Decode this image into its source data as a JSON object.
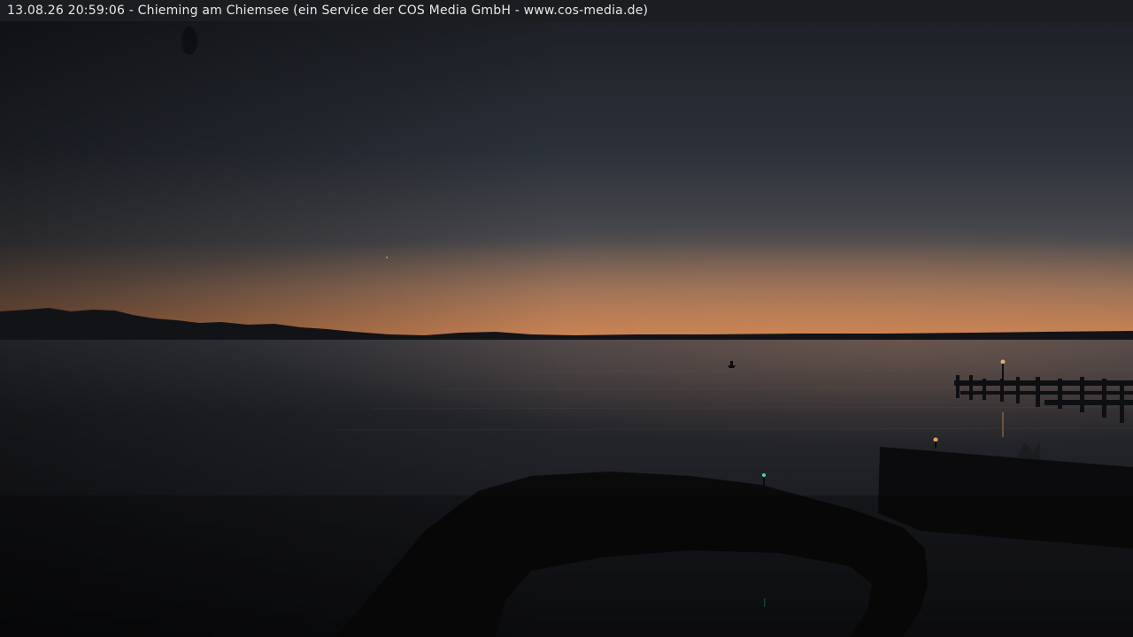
{
  "webcam": {
    "timestamp": "13.08.26 20:59:06",
    "separator": " - ",
    "caption": "Chieming am Chiemsee (ein Service der COS Media GmbH - www.cos-media.de)"
  },
  "colors": {
    "sky_top": "#1b1e24",
    "sky_mid": "#353a44",
    "horizon_glow": "#c07a4e",
    "water": "#16181d",
    "silhouette": "#0d0d0f",
    "caption_bar": "#1c1d21",
    "caption_text": "#e8e8e8"
  }
}
